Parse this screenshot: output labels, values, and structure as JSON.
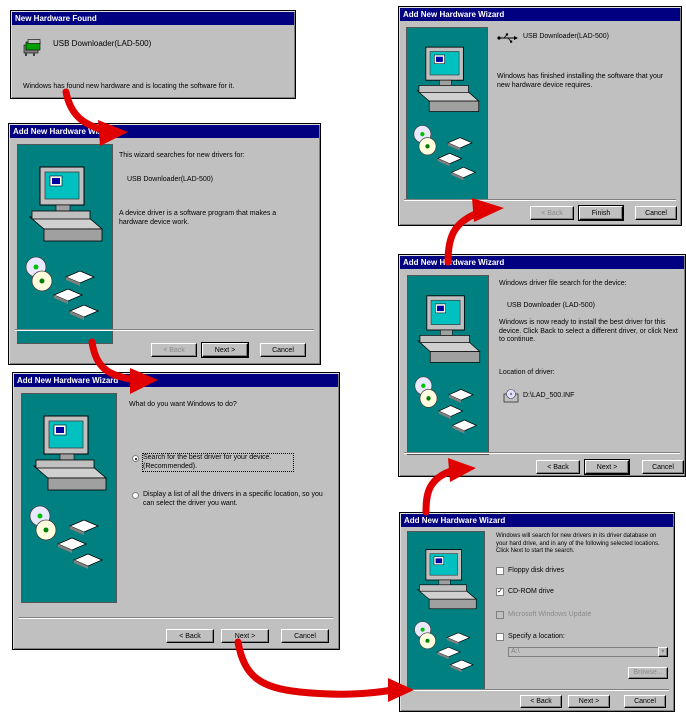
{
  "new_hw": {
    "title": "New Hardware Found",
    "device": "USB Downloader(LAD-500)",
    "message": "Windows has found new hardware and is locating the software for it."
  },
  "wiz1": {
    "title": "Add New Hardware Wizard",
    "intro": "This wizard searches for new drivers for:",
    "device": "USB Downloader(LAD-500)",
    "desc": "A device driver is a software program that makes a hardware device work.",
    "back": "< Back",
    "next": "Next >",
    "cancel": "Cancel"
  },
  "wiz2": {
    "title": "Add New Hardware Wizard",
    "question": "What do you want Windows to do?",
    "option1": "Search for the best driver for your device. (Recommended).",
    "option2": "Display a list of all the drivers in a specific location, so you can select the driver you want.",
    "selected_option": 1,
    "back": "< Back",
    "next": "Next >",
    "cancel": "Cancel"
  },
  "wiz3": {
    "title": "Add New Hardware Wizard",
    "desc": "Windows will search for new drivers in its driver database on your hard drive, and in any of the following selected locations. Click Next to start the search.",
    "floppy": "Floppy disk drives",
    "floppy_checked": false,
    "cdrom": "CD-ROM drive",
    "cdrom_checked": true,
    "update": "Microsoft Windows Update",
    "specify": "Specify a location:",
    "specify_checked": false,
    "location_value": "A:\\",
    "browse": "Browse...",
    "back": "< Back",
    "next": "Next >",
    "cancel": "Cancel"
  },
  "wiz4": {
    "title": "Add New Hardware Wizard",
    "intro": "Windows driver file search for the device:",
    "device": "USB Downloader (LAD-500)",
    "desc": "Windows is now ready to install the best driver for this device. Click Back to select a different driver, or click Next to continue.",
    "location_label": "Location of driver:",
    "location": "D:\\LAD_500.INF",
    "back": "< Back",
    "next": "Next >",
    "cancel": "Cancel"
  },
  "wiz5": {
    "title": "Add New Hardware Wizard",
    "device": "USB Downloader(LAD-500)",
    "desc": "Windows has finished installing the software that your new hardware device requires.",
    "back": "< Back",
    "finish": "Finish",
    "cancel": "Cancel"
  },
  "colors": {
    "titlebar": "#000080",
    "dialog": "#c0c0c0",
    "art_bg": "#008080",
    "arrow": "#e00000"
  },
  "icons": [
    "hardware-icon",
    "usb-icon",
    "cd-drive-icon",
    "wizard-computer-icon",
    "flow-arrow-icon"
  ]
}
